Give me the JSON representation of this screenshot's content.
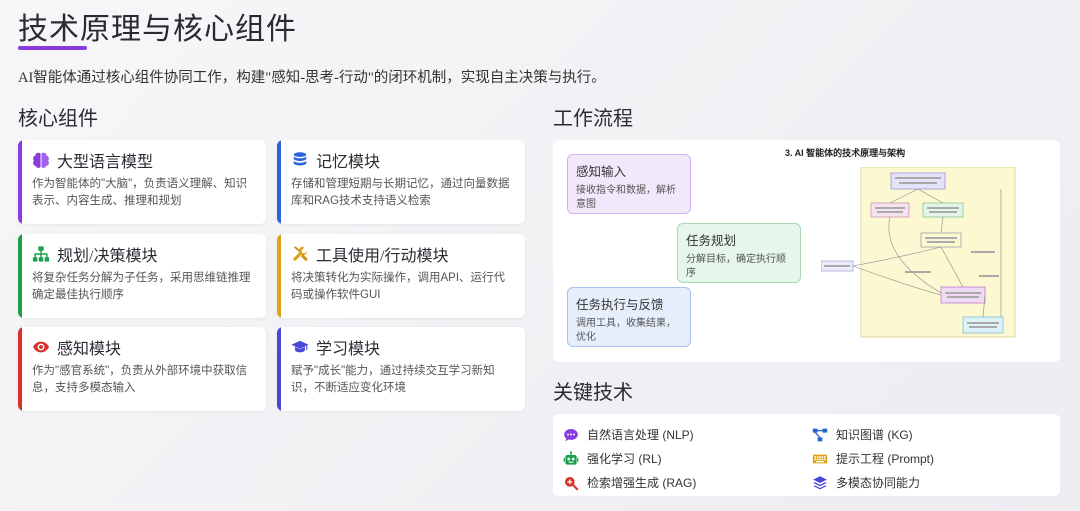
{
  "page": {
    "title": "技术原理与核心组件",
    "intro": "AI智能体通过核心组件协同工作，构建\"感知-思考-行动\"的闭环机制，实现自主决策与执行。",
    "accent": "#8a3be0"
  },
  "components": {
    "heading": "核心组件",
    "cards": [
      {
        "title": "大型语言模型",
        "desc": "作为智能体的\"大脑\"，负责语义理解、知识表示、内容生成、推理和规划",
        "color": "#8a3be0",
        "icon": "brain-icon"
      },
      {
        "title": "记忆模块",
        "desc": "存储和管理短期与长期记忆，通过向量数据库和RAG技术支持语义检索",
        "color": "#2b64d9",
        "icon": "database-icon"
      },
      {
        "title": "规划/决策模块",
        "desc": "将复杂任务分解为子任务，采用思维链推理确定最佳执行顺序",
        "color": "#1e9e4a",
        "icon": "sitemap-icon"
      },
      {
        "title": "工具使用/行动模块",
        "desc": "将决策转化为实际操作，调用API、运行代码或操作软件GUI",
        "color": "#e0a21a",
        "icon": "tools-icon"
      },
      {
        "title": "感知模块",
        "desc": "作为\"感官系统\"，负责从外部环境中获取信息，支持多模态输入",
        "color": "#d9302b",
        "icon": "eye-icon"
      },
      {
        "title": "学习模块",
        "desc": "赋予\"成长\"能力，通过持续交互学习新知识，不断适应变化环境",
        "color": "#4a47d6",
        "icon": "graduation-cap-icon"
      }
    ]
  },
  "workflow": {
    "heading": "工作流程",
    "steps": [
      {
        "title": "感知输入",
        "desc": "接收指令和数据，解析意图"
      },
      {
        "title": "任务规划",
        "desc": "分解目标，确定执行顺序"
      },
      {
        "title": "任务执行与反馈",
        "desc": "调用工具，收集结果，优化"
      }
    ],
    "architecture_title": "3. AI 智能体的技术原理与架构"
  },
  "key_tech": {
    "heading": "关键技术",
    "items": [
      {
        "label": "自然语言处理 (NLP)",
        "icon": "comment-dots-icon",
        "color": "#8a3be0"
      },
      {
        "label": "知识图谱 (KG)",
        "icon": "project-diagram-icon",
        "color": "#2b64d9"
      },
      {
        "label": "强化学习 (RL)",
        "icon": "robot-icon",
        "color": "#1e9e4a"
      },
      {
        "label": "提示工程 (Prompt)",
        "icon": "keyboard-icon",
        "color": "#e0a21a"
      },
      {
        "label": "检索增强生成 (RAG)",
        "icon": "search-plus-icon",
        "color": "#d9302b"
      },
      {
        "label": "多模态协同能力",
        "icon": "layer-group-icon",
        "color": "#4a47d6"
      }
    ]
  }
}
